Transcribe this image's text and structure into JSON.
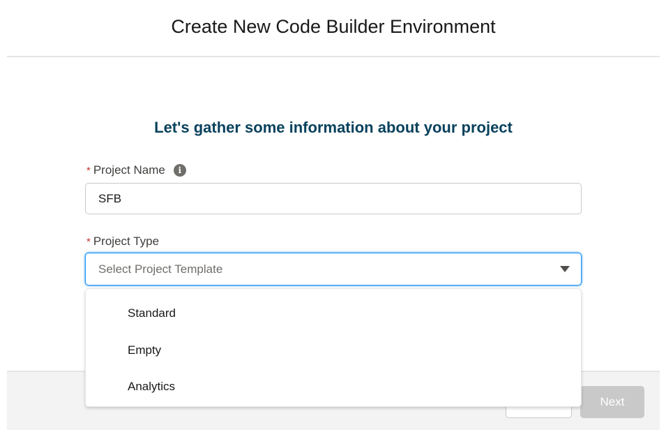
{
  "modal": {
    "title": "Create New Code Builder Environment",
    "section_heading": "Let's gather some information about your project"
  },
  "form": {
    "project_name": {
      "label": "Project Name",
      "required_marker": "*",
      "value": "SFB"
    },
    "project_type": {
      "label": "Project Type",
      "required_marker": "*",
      "placeholder": "Select Project Template",
      "options": [
        "Standard",
        "Empty",
        "Analytics"
      ]
    }
  },
  "footer": {
    "next_label": "Next"
  },
  "colors": {
    "heading": "#08415c",
    "required": "#c23934",
    "focus_border": "#1b96ff",
    "disabled_button": "#c9c9c9"
  }
}
